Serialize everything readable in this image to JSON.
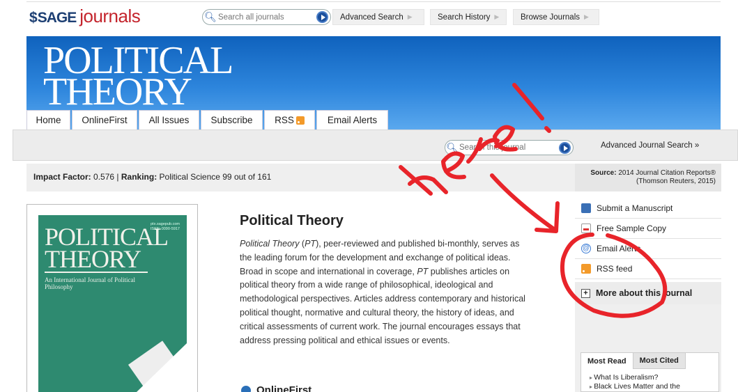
{
  "topbar": {
    "logo_sage": "SAGE",
    "logo_journals": "journals",
    "search_placeholder": "Search all journals",
    "links": [
      "Advanced Search",
      "Search History",
      "Browse Journals"
    ]
  },
  "banner": {
    "title_line1": "POLITICAL",
    "title_line2": "THEORY",
    "tabs": [
      "Home",
      "OnlineFirst",
      "All Issues",
      "Subscribe",
      "RSS",
      "Email Alerts"
    ]
  },
  "journal_search": {
    "placeholder": "Search this journal",
    "advanced_label": "Advanced Journal Search »"
  },
  "impact": {
    "impact_label": "Impact Factor:",
    "impact_value": "0.576",
    "ranking_label": "Ranking:",
    "ranking_value": "Political Science 99 out of 161",
    "source_label": "Source:",
    "source_value": "2014 Journal Citation Reports®",
    "source_value2": "(Thomson Reuters, 2015)"
  },
  "cover": {
    "title_line1": "POLITICAL",
    "title_line2": "THEORY",
    "subtitle": "An International Journal of Political Philosophy",
    "url_line1": "ptx.sagepub.com",
    "url_line2": "ISSN: 0090-5917"
  },
  "main": {
    "title": "Political Theory",
    "desc_em1": "Political Theory",
    "desc_paren_open": " (",
    "desc_em2": "PT",
    "desc_part1": "), peer-reviewed and published bi-monthly, serves as the leading forum for the development and exchange of political ideas. Broad in scope and international in coverage, ",
    "desc_em3": "PT",
    "desc_part2": " publishes articles on political theory from a wide range of philosophical, ideological and methodological perspectives. Articles address contemporary and historical political thought, normative and cultural theory, the history of ideas, and critical assessments of current work. The journal encourages essays that address pressing political and ethical issues or events.",
    "onlinefirst_label": "OnlineFirst"
  },
  "sidebar": {
    "items": [
      {
        "label": "Submit a Manuscript",
        "icon": "submit-icon"
      },
      {
        "label": "Free Sample Copy",
        "icon": "pdf-icon"
      },
      {
        "label": "Email Alerts",
        "icon": "email-icon"
      },
      {
        "label": "RSS feed",
        "icon": "rss-icon"
      }
    ],
    "more_label": "More about this journal",
    "most_read_tab": "Most Read",
    "most_cited_tab": "Most Cited",
    "list": [
      "What Is Liberalism?",
      "Black Lives Matter and the"
    ]
  },
  "annotation": {
    "handwritten_text": "here!",
    "color": "#e8242a"
  }
}
